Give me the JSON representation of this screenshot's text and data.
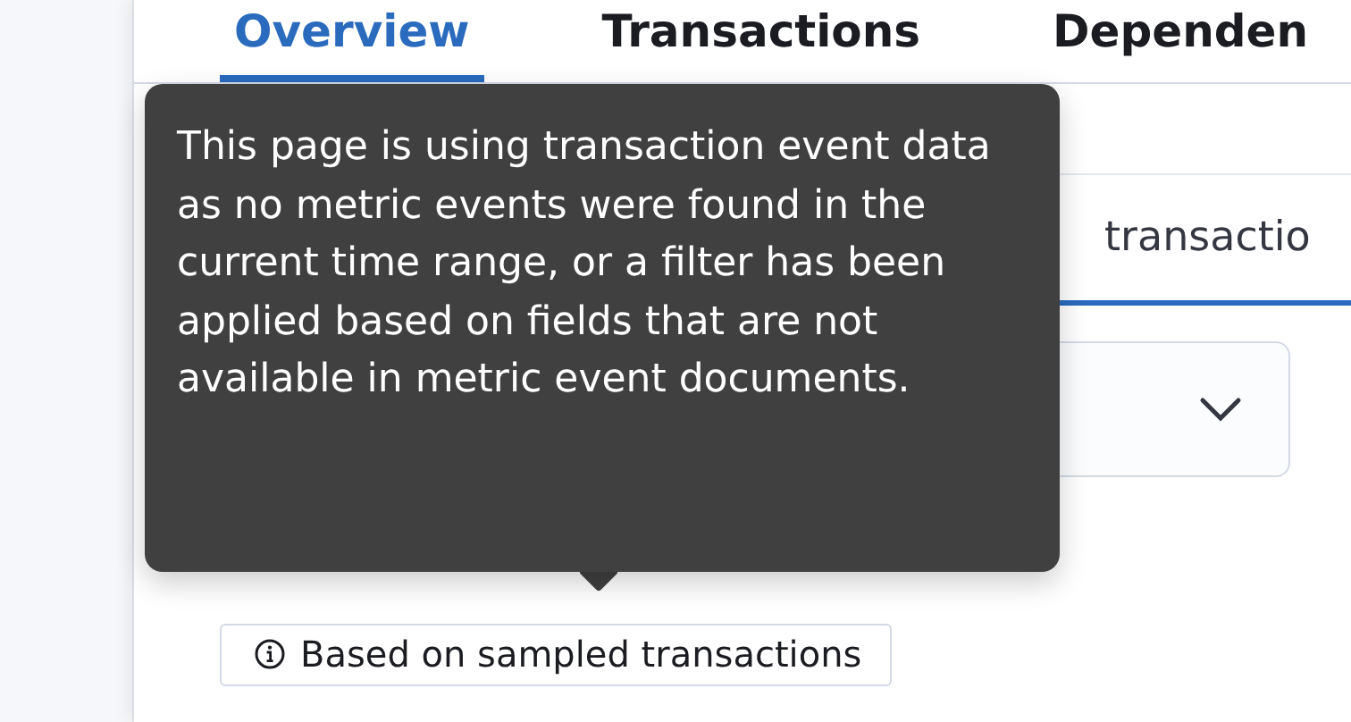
{
  "tabs": [
    {
      "label": "Overview",
      "selected": true
    },
    {
      "label": "Transactions",
      "selected": false
    },
    {
      "label": "Dependen",
      "selected": false
    }
  ],
  "search": {
    "value": "transactio"
  },
  "dropdown": {
    "expanded": false
  },
  "tooltip": {
    "text": "This page is using transaction event data as no metric events were found in the current time range, or a filter has been applied based on fields that are not available in metric event documents."
  },
  "badge": {
    "label": "Based on sampled transactions"
  }
}
